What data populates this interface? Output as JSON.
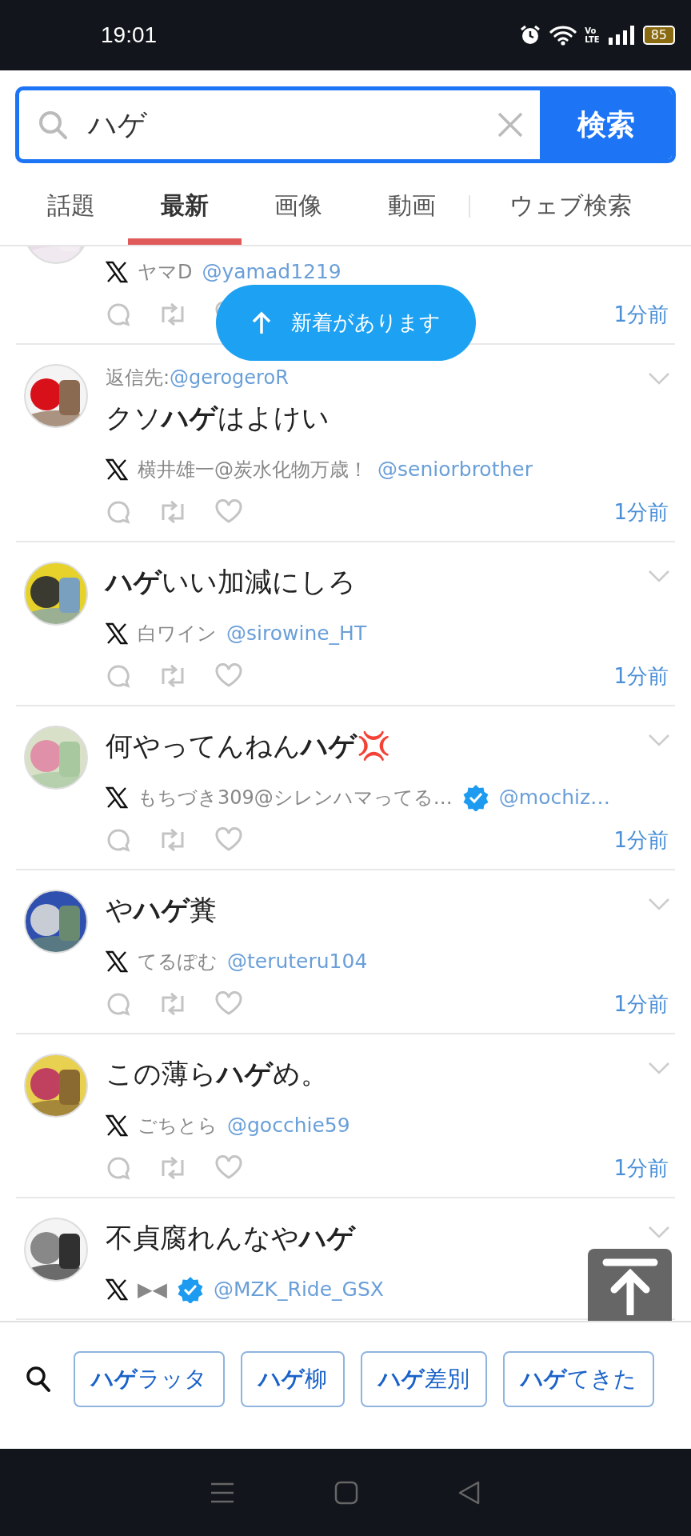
{
  "status_bar": {
    "time": "19:01",
    "network_label": [
      "Vo",
      "LTE"
    ],
    "battery": "85"
  },
  "search": {
    "value": "ハゲ",
    "button": "検索"
  },
  "tabs": [
    {
      "label": "話題",
      "selected": false
    },
    {
      "label": "最新",
      "selected": true
    },
    {
      "label": "画像",
      "selected": false
    },
    {
      "label": "動画",
      "selected": false
    },
    {
      "label": "ウェブ検索",
      "selected": false
    }
  ],
  "new_posts_banner": "新着があります",
  "posts": [
    {
      "name": "ヤマD",
      "verified": false,
      "handle": "@yamad1219",
      "time": "1分前"
    },
    {
      "reply_to": "返信先:",
      "reply_handle": "@gerogeroR",
      "text": "クソ**ハゲ**はよけい",
      "name": "横井雄一@炭水化物万歳！",
      "verified": false,
      "handle": "@seniorbrother",
      "time": "1分前"
    },
    {
      "text": "**ハゲ**いい加減にしろ",
      "name": "白ワイン",
      "verified": false,
      "handle": "@sirowine_HT",
      "time": "1分前"
    },
    {
      "text": "何やってんねん**ハゲ**💢",
      "name": "もちづき309@シレンハマってる…",
      "verified": true,
      "handle": "@mochiz…",
      "time": "1分前"
    },
    {
      "text": "や**ハゲ**糞",
      "name": "てるぽむ",
      "verified": false,
      "handle": "@teruteru104",
      "time": "1分前"
    },
    {
      "text": "この薄ら**ハゲ**め。",
      "name": "ごちとら",
      "verified": false,
      "handle": "@gocchie59",
      "time": "1分前"
    },
    {
      "text": "不貞腐れんなや**ハゲ**",
      "name": "▶◀",
      "verified": true,
      "handle": "@MZK_Ride_GSX"
    }
  ],
  "suggestions": [
    "**ハゲ**ラッタ",
    "**ハゲ**柳",
    "**ハゲ**差別",
    "**ハゲ**てきた"
  ]
}
